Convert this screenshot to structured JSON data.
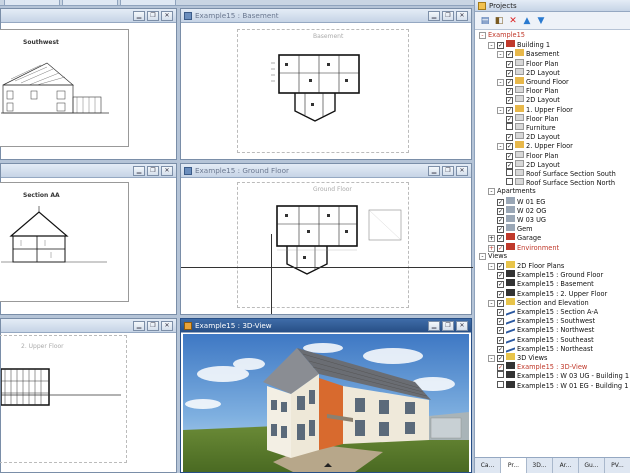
{
  "top_tabs": [
    "",
    "",
    ""
  ],
  "windows": {
    "top_left": {
      "title": "",
      "drawing_label": "Southwest"
    },
    "top_middle": {
      "title": "Example15 : Basement",
      "drawing_label": "Basement"
    },
    "mid_left": {
      "title": "",
      "drawing_label": "Section AA"
    },
    "mid_middle": {
      "title": "Example15 : Ground Floor",
      "drawing_label": "Ground Floor"
    },
    "bot_left": {
      "title": "",
      "drawing_label": "2. Upper Floor"
    },
    "bot_right": {
      "title": "Example15 : 3D-View"
    }
  },
  "window_buttons": {
    "minimize": "▁",
    "restore": "❐",
    "close": "✕"
  },
  "projects_panel": {
    "title": "Projects",
    "toolbar_icons": [
      "new-project-icon",
      "properties-icon",
      "delete-icon",
      "move-up-icon",
      "move-down-icon"
    ],
    "tree": [
      {
        "level": 0,
        "exp": "-",
        "label": "Example15",
        "red": true
      },
      {
        "level": 1,
        "exp": "-",
        "cb": "✓",
        "icon": "building",
        "label": "Building 1"
      },
      {
        "level": 2,
        "exp": "-",
        "cb": "✓",
        "icon": "floor",
        "label": "Basement"
      },
      {
        "level": 3,
        "cb": "✓",
        "icon": "layer",
        "label": "Floor Plan"
      },
      {
        "level": 3,
        "cb": "✓",
        "icon": "layer",
        "label": "2D Layout"
      },
      {
        "level": 2,
        "exp": "-",
        "cb": "✓",
        "icon": "floor",
        "label": "Ground Floor"
      },
      {
        "level": 3,
        "cb": "✓",
        "icon": "layer",
        "label": "Floor Plan"
      },
      {
        "level": 3,
        "cb": "✓",
        "icon": "layer",
        "label": "2D Layout"
      },
      {
        "level": 2,
        "exp": "-",
        "cb": "✓",
        "icon": "floor",
        "label": "1. Upper Floor"
      },
      {
        "level": 3,
        "cb": "✓",
        "icon": "layer",
        "label": "Floor Plan"
      },
      {
        "level": 3,
        "cb": "",
        "icon": "layer",
        "label": "Furniture"
      },
      {
        "level": 3,
        "cb": "✓",
        "icon": "layer",
        "label": "2D Layout"
      },
      {
        "level": 2,
        "exp": "-",
        "cb": "✓",
        "icon": "floor",
        "label": "2. Upper Floor"
      },
      {
        "level": 3,
        "cb": "✓",
        "icon": "layer",
        "label": "Floor Plan"
      },
      {
        "level": 3,
        "cb": "✓",
        "icon": "layer",
        "label": "2D Layout"
      },
      {
        "level": 3,
        "cb": "",
        "icon": "layer",
        "label": "Roof Surface Section South"
      },
      {
        "level": 3,
        "cb": "",
        "icon": "layer",
        "label": "Roof Surface Section North"
      },
      {
        "level": 1,
        "exp": "-",
        "label": "Apartments"
      },
      {
        "level": 2,
        "cb": "✓",
        "icon": "apt",
        "label": "W 01 EG"
      },
      {
        "level": 2,
        "cb": "✓",
        "icon": "apt",
        "label": "W 02 OG"
      },
      {
        "level": 2,
        "cb": "✓",
        "icon": "apt",
        "label": "W 03 UG"
      },
      {
        "level": 2,
        "cb": "✓",
        "icon": "apt",
        "label": "Gem"
      },
      {
        "level": 1,
        "exp": "+",
        "cb": "✓",
        "icon": "building",
        "label": "Garage"
      },
      {
        "level": 1,
        "exp": "+",
        "cb": "✓",
        "icon": "building",
        "label": "Environment",
        "red": true
      },
      {
        "level": 0,
        "exp": "-",
        "label": "Views"
      },
      {
        "level": 1,
        "exp": "-",
        "cb": "✓",
        "icon": "folder",
        "label": "2D Floor Plans"
      },
      {
        "level": 2,
        "cb": "✓",
        "icon": "2d",
        "label": "Example15 : Ground Floor"
      },
      {
        "level": 2,
        "cb": "✓",
        "icon": "2d",
        "label": "Example15 : Basement"
      },
      {
        "level": 2,
        "cb": "✓",
        "icon": "2d",
        "label": "Example15 : 2. Upper Floor"
      },
      {
        "level": 1,
        "exp": "-",
        "cb": "✓",
        "icon": "folder",
        "label": "Section and Elevation"
      },
      {
        "level": 2,
        "cb": "✓",
        "icon": "sect",
        "label": "Example15 : Section A-A"
      },
      {
        "level": 2,
        "cb": "✓",
        "icon": "sect",
        "label": "Example15 : Southwest"
      },
      {
        "level": 2,
        "cb": "✓",
        "icon": "sect",
        "label": "Example15 : Northwest"
      },
      {
        "level": 2,
        "cb": "✓",
        "icon": "sect",
        "label": "Example15 : Southeast"
      },
      {
        "level": 2,
        "cb": "✓",
        "icon": "sect",
        "label": "Example15 : Northeast"
      },
      {
        "level": 1,
        "exp": "-",
        "cb": "✓",
        "icon": "folder",
        "label": "3D Views"
      },
      {
        "level": 2,
        "cb": "✓",
        "icon": "3d",
        "label": "Example15 : 3D-View",
        "red": true
      },
      {
        "level": 2,
        "cb": "",
        "icon": "3d",
        "label": "Example15 : W 03 UG - Building 1 -"
      },
      {
        "level": 2,
        "cb": "",
        "icon": "3d",
        "label": "Example15 : W 01 EG - Building 1 -"
      }
    ],
    "bottom_tabs": [
      "Ca...",
      "Pr...",
      "3D...",
      "Ar...",
      "Gu...",
      "PV..."
    ]
  }
}
